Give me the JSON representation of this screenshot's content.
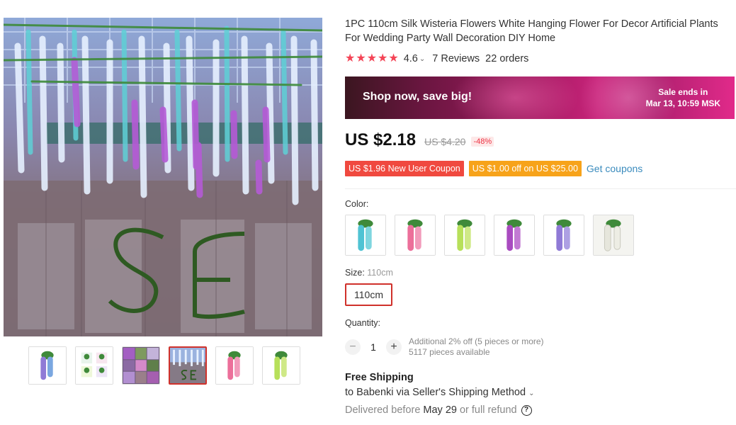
{
  "product": {
    "title": "1PC 110cm Silk Wisteria Flowers White Hanging Flower For Decor Artificial Plants For Wedding Party Wall Decoration DIY Home",
    "main_image_icon": "wisteria-photo",
    "rating": {
      "stars": 5,
      "value": "4.6",
      "reviews": "7 Reviews",
      "orders": "22 orders"
    }
  },
  "gallery": {
    "thumbnails": [
      {
        "icon": "blue-purple-wisteria"
      },
      {
        "icon": "four-color-wisteria"
      },
      {
        "icon": "purple-wisteria-collage"
      },
      {
        "icon": "wisteria-wall-photo",
        "active": true
      },
      {
        "icon": "pink-wisteria"
      },
      {
        "icon": "green-wisteria"
      }
    ]
  },
  "banner": {
    "headline": "Shop now, save big!",
    "sale_ends_label": "Sale ends in",
    "sale_ends_date": "Mar 13, 10:59 MSK"
  },
  "price": {
    "current": "US $2.18",
    "original": "US $4.20",
    "discount": "-48%"
  },
  "coupons": {
    "new_user": "US $1.96 New User Coupon",
    "threshold": "US $1.00 off on US $25.00",
    "get_link": "Get coupons"
  },
  "color": {
    "label": "Color:",
    "options": [
      {
        "icon": "blue-wisteria",
        "color": "#4fc3d3"
      },
      {
        "icon": "pink-wisteria",
        "color": "#ec6f9a"
      },
      {
        "icon": "green-wisteria",
        "color": "#b7e05a"
      },
      {
        "icon": "purple-wisteria",
        "color": "#a94bc0"
      },
      {
        "icon": "lavender-wisteria",
        "color": "#8f7ad6"
      },
      {
        "icon": "white-wisteria",
        "color": "#f2f2ea"
      }
    ]
  },
  "size": {
    "label": "Size:",
    "selected_value": "110cm",
    "button_label": "110cm"
  },
  "quantity": {
    "label": "Quantity:",
    "value": "1",
    "minus": "−",
    "plus": "+",
    "discount_note": "Additional 2% off (5 pieces or more)",
    "available": "5117 pieces available"
  },
  "shipping": {
    "title": "Free Shipping",
    "method": "to Babenki via Seller's Shipping Method",
    "delivered_prefix": "Delivered before",
    "delivered_date": "May 29",
    "delivered_suffix": "or full refund",
    "help_icon": "?"
  },
  "colors": {
    "accent_red": "#d0312b",
    "star": "#f44456",
    "coupon_red": "#f0493f",
    "coupon_orange": "#f7a31a",
    "link_blue": "#3a8bbd"
  }
}
